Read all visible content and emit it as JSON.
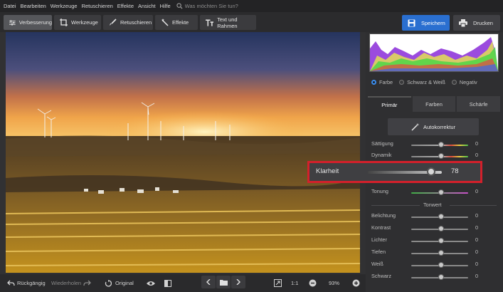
{
  "menu": {
    "items": [
      "Datei",
      "Bearbeiten",
      "Werkzeuge",
      "Retuschieren",
      "Effekte",
      "Ansicht",
      "Hilfe"
    ],
    "search_placeholder": "Was möchten Sie tun?"
  },
  "tabs": [
    {
      "label": "Verbesserung",
      "icon": "sliders-icon",
      "active": true
    },
    {
      "label": "Werkzeuge",
      "icon": "crop-icon",
      "active": false
    },
    {
      "label": "Retuschieren",
      "icon": "brush-icon",
      "active": false
    },
    {
      "label": "Effekte",
      "icon": "magic-wand-icon",
      "active": false
    },
    {
      "label": "Text und Rahmen",
      "icon": "text-icon",
      "active": false
    }
  ],
  "actions": {
    "save": "Speichern",
    "print": "Drucken"
  },
  "colors": {
    "accent": "#2a6fd0",
    "highlight_border": "#d3202b"
  },
  "color_mode": {
    "options": [
      "Farbe",
      "Schwarz & Weiß",
      "Negativ"
    ],
    "selected": "Farbe"
  },
  "panel_tabs": [
    "Primär",
    "Farben",
    "Schärfe"
  ],
  "autocorrect": "Autokorrektur",
  "sliders_top": [
    {
      "label": "Sättigung",
      "value": "0"
    },
    {
      "label": "Dynamik",
      "value": "0"
    }
  ],
  "highlight_slider": {
    "label": "Klarheit",
    "value": "78"
  },
  "toning": {
    "label": "Tonung",
    "value": "0"
  },
  "tonwert": {
    "title": "Tonwert",
    "sliders": [
      {
        "label": "Belichtung",
        "value": "0"
      },
      {
        "label": "Kontrast",
        "value": "0"
      },
      {
        "label": "Lichter",
        "value": "0"
      },
      {
        "label": "Tiefen",
        "value": "0"
      },
      {
        "label": "Weiß",
        "value": "0"
      },
      {
        "label": "Schwarz",
        "value": "0"
      }
    ]
  },
  "bottom": {
    "undo": "Rückgängig",
    "redo": "Wiederholen",
    "original": "Original",
    "ratio": "1:1",
    "zoom": "93%"
  }
}
